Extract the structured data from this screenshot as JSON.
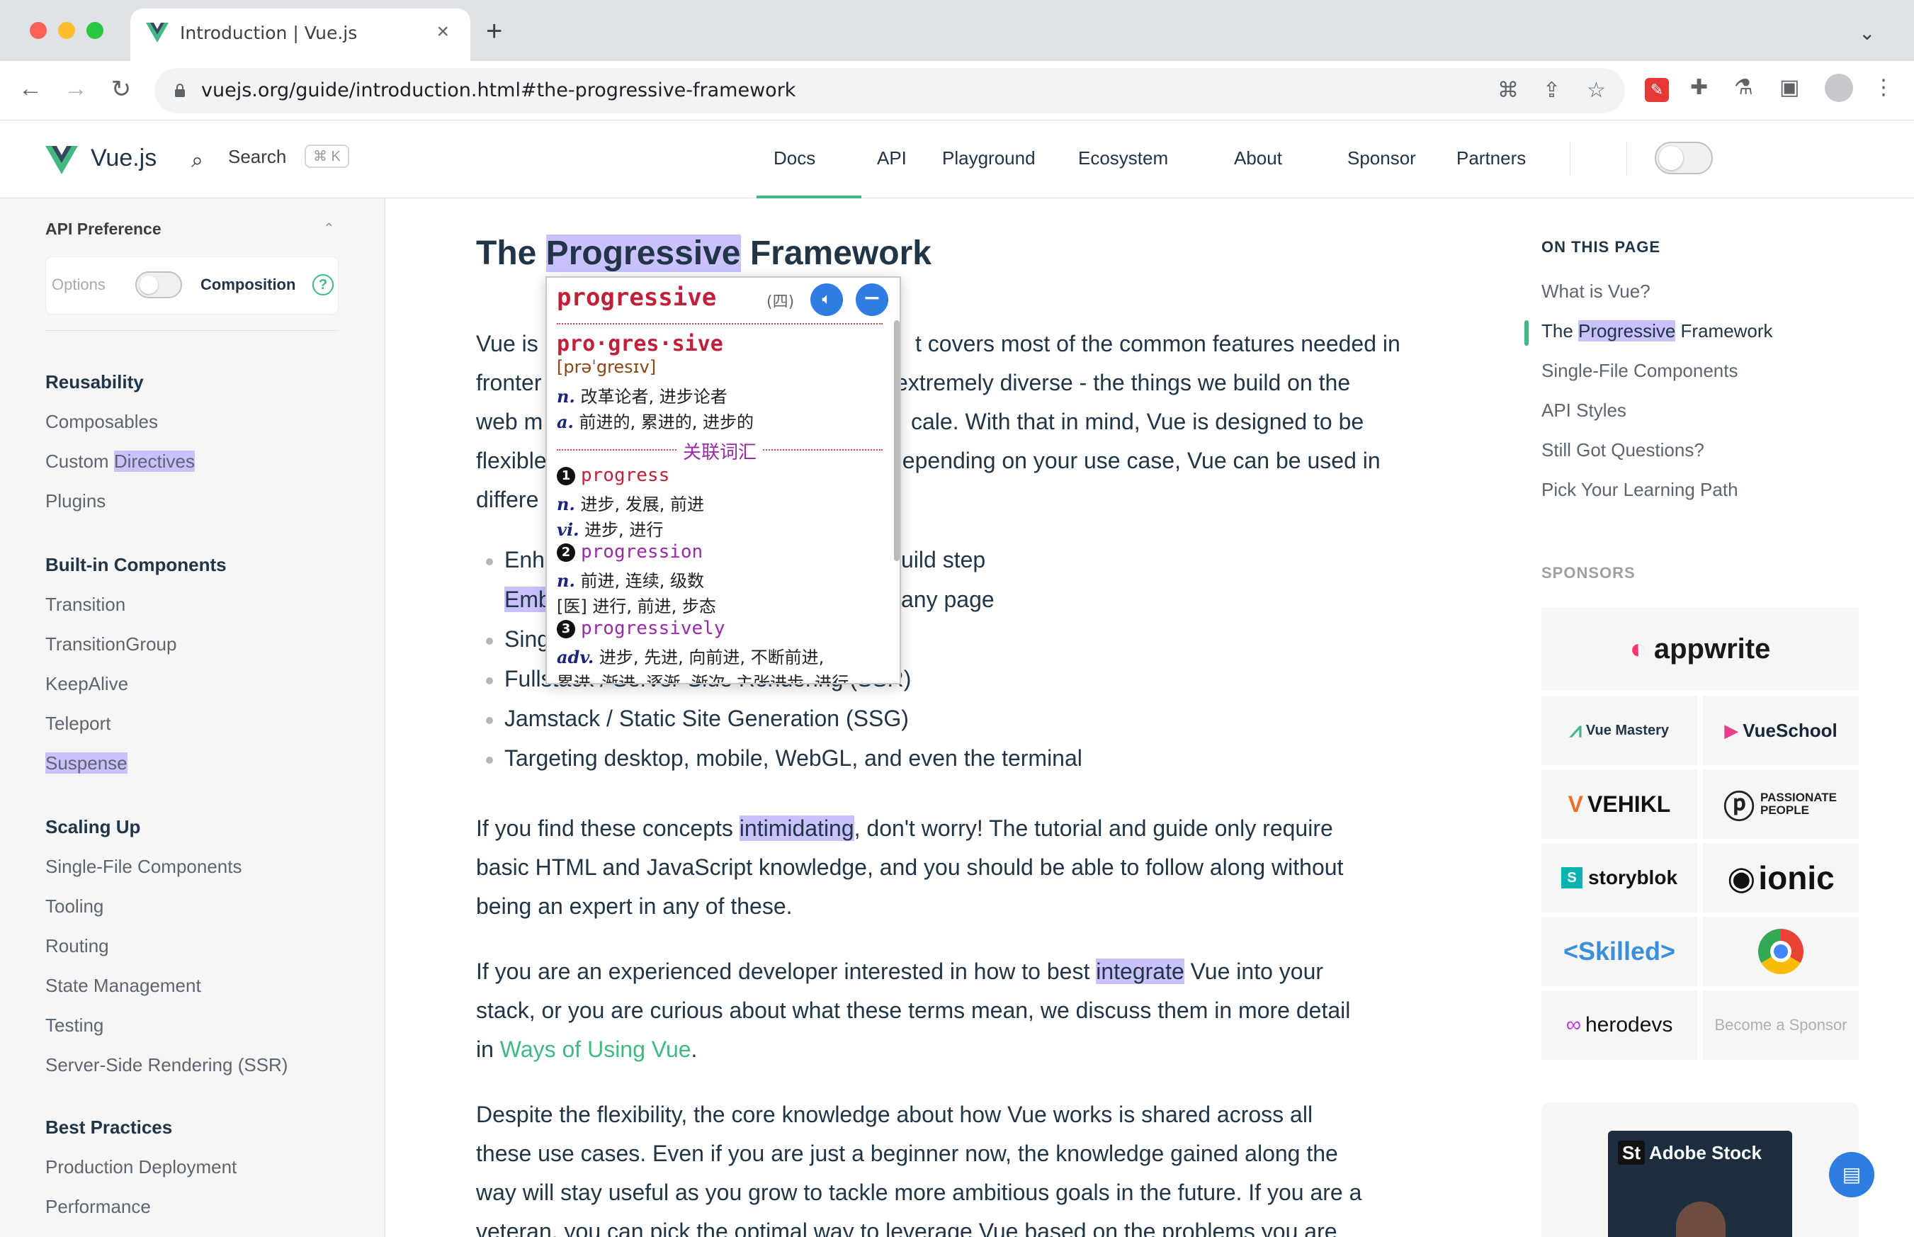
{
  "browser": {
    "tab_title": "Introduction | Vue.js",
    "url": "vuejs.org/guide/introduction.html#the-progressive-framework"
  },
  "site_nav": {
    "brand": "Vue.js",
    "search_label": "Search",
    "search_kbd": "⌘ K",
    "links": [
      "Docs",
      "API",
      "Playground",
      "Ecosystem",
      "About",
      "Sponsor",
      "Partners"
    ]
  },
  "sidebar": {
    "api_preference": "API Preference",
    "options_label": "Options",
    "composition_label": "Composition",
    "help": "?",
    "sections": [
      {
        "title": "Reusability",
        "items": [
          "Composables",
          "Custom Directives",
          "Plugins"
        ]
      },
      {
        "title": "Built-in Components",
        "items": [
          "Transition",
          "TransitionGroup",
          "KeepAlive",
          "Teleport",
          "Suspense"
        ]
      },
      {
        "title": "Scaling Up",
        "items": [
          "Single-File Components",
          "Tooling",
          "Routing",
          "State Management",
          "Testing",
          "Server-Side Rendering (SSR)"
        ]
      },
      {
        "title": "Best Practices",
        "items": [
          "Production Deployment",
          "Performance"
        ]
      }
    ]
  },
  "main": {
    "heading_pre": "The ",
    "heading_hl": "Progressive",
    "heading_post": " Framework",
    "p1_lines": [
      "Vue is",
      "fronter",
      "web m",
      "flexible",
      "differe"
    ],
    "p1_right": [
      "t covers most of the common features needed in",
      "extremely diverse - the things we build on the",
      "cale. With that in mind, Vue is designed to be",
      "depending on your use case, Vue can be used in",
      ""
    ],
    "list": [
      {
        "left": "Enh",
        "right": "uild step"
      },
      {
        "left": "Emb",
        "right": "any page"
      },
      {
        "left": "Sing",
        "right": ""
      },
      {
        "left": "Fullstack / Server-Side Rendering (SSR)",
        "right": ""
      },
      {
        "left": "Jamstack / Static Site Generation (SSG)",
        "right": ""
      },
      {
        "left": "Targeting desktop, mobile, WebGL, and even the terminal",
        "right": ""
      }
    ],
    "p2": {
      "a": "If you find these concepts ",
      "hl": "intimidating",
      "b": ", don't worry! The tutorial and guide only require",
      "l2": "basic HTML and JavaScript knowledge, and you should be able to follow along without",
      "l3": "being an expert in any of these."
    },
    "p3": {
      "a": "If you are an experienced developer interested in how to best ",
      "hl": "integrate",
      "b": " Vue into your",
      "l2": "stack, or you are curious about what these terms mean, we discuss them in more detail",
      "l3a": "in ",
      "link": "Ways of Using Vue",
      "l3b": "."
    },
    "p4": [
      "Despite the flexibility, the core knowledge about how Vue works is shared across all",
      "these use cases. Even if you are just a beginner now, the knowledge gained along the",
      "way will stay useful as you grow to tackle more ambitious goals in the future. If you are a",
      "veteran, you can pick the optimal way to leverage Vue based on the problems you are"
    ]
  },
  "popup": {
    "word": "progressive",
    "source": "(四)",
    "syllables": "pro·gres·sive",
    "phonetic": "[prəˈgresɪv]",
    "defs": [
      {
        "pos": "n.",
        "text": "改革论者, 进步论者"
      },
      {
        "pos": "a.",
        "text": "前进的, 累进的, 进步的"
      }
    ],
    "related_label": "关联词汇",
    "related": [
      {
        "num": "1",
        "word": "progress",
        "defs": [
          {
            "pos": "n.",
            "text": "进步, 发展, 前进"
          },
          {
            "pos": "vi.",
            "text": "进步, 进行"
          }
        ]
      },
      {
        "num": "2",
        "word": "progression",
        "defs": [
          {
            "pos": "n.",
            "text": "前进, 连续, 级数"
          },
          {
            "pos": "",
            "text": "[医] 进行, 前进, 步态"
          }
        ]
      },
      {
        "num": "3",
        "word": "progressively",
        "defs": [
          {
            "pos": "adv.",
            "text": "进步, 先进, 向前进, 不断前进,"
          },
          {
            "pos": "",
            "text": "累进, 渐进, 逐渐, 渐次, 主张进步, 进行"
          }
        ]
      }
    ]
  },
  "aside": {
    "on_this_page": "ON THIS PAGE",
    "toc": [
      "What is Vue?",
      "The Progressive Framework",
      "Single-File Components",
      "API Styles",
      "Still Got Questions?",
      "Pick Your Learning Path"
    ],
    "toc_active": {
      "pre": "The ",
      "hl": "Progressive",
      "post": " Framework"
    },
    "sponsors_label": "SPONSORS",
    "sponsors": [
      "appwrite",
      "Vue Mastery",
      "VueSchool",
      "VEHIKL",
      "PASSIONATE PEOPLE",
      "storyblok",
      "ionic",
      "<Skilled>",
      "",
      "herodevs",
      "Become a Sponsor"
    ],
    "ad_text": "Adobe Stock"
  },
  "colors": {
    "accent": "#42b883",
    "highlight": "#c9c2ff",
    "popup_word": "#c0213a",
    "related": "#9b2aa8"
  }
}
